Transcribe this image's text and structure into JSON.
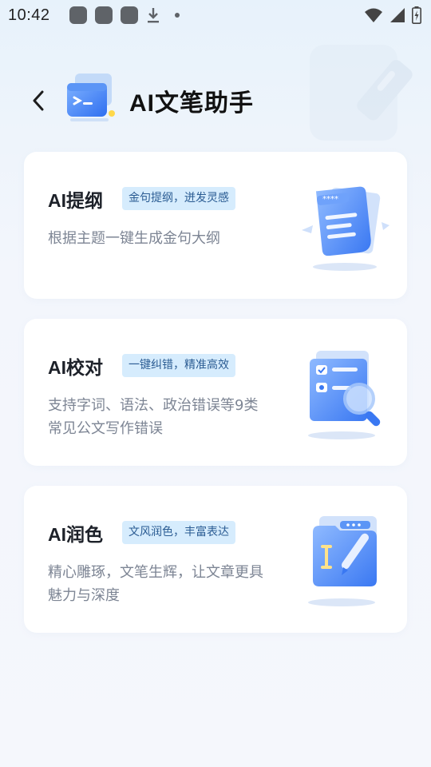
{
  "status_bar": {
    "time": "10:42",
    "notification_icons": [
      "app-notification-icon",
      "app-notification-icon",
      "app-notification-icon",
      "download-icon",
      "more-dot-icon"
    ],
    "right_icons": [
      "wifi-icon",
      "cellular-signal-icon",
      "battery-charging-icon"
    ]
  },
  "header": {
    "title": "AI文笔助手",
    "back_icon": "chevron-left-icon",
    "logo_icon": "terminal-window-icon"
  },
  "cards": [
    {
      "title": "AI提纲",
      "badge": "金句提纲，迸发灵感",
      "description": "根据主题一键生成金句大纲",
      "illustration": "outline-document-icon",
      "mask_text": "****"
    },
    {
      "title": "AI校对",
      "badge": "一键纠错，精准高效",
      "description": "支持字词、语法、政治错误等9类常见公文写作错误",
      "illustration": "proofread-magnifier-icon"
    },
    {
      "title": "AI润色",
      "badge": "文风润色，丰富表达",
      "description": "精心雕琢，文笔生辉，让文章更具魅力与深度",
      "illustration": "polish-pen-icon"
    }
  ],
  "colors": {
    "accent_blue": "#3d7df5",
    "badge_bg": "#d6ecfd",
    "badge_text": "#2b5c93",
    "description_gray": "#7d8594",
    "page_bg": "#f5f7fc"
  }
}
